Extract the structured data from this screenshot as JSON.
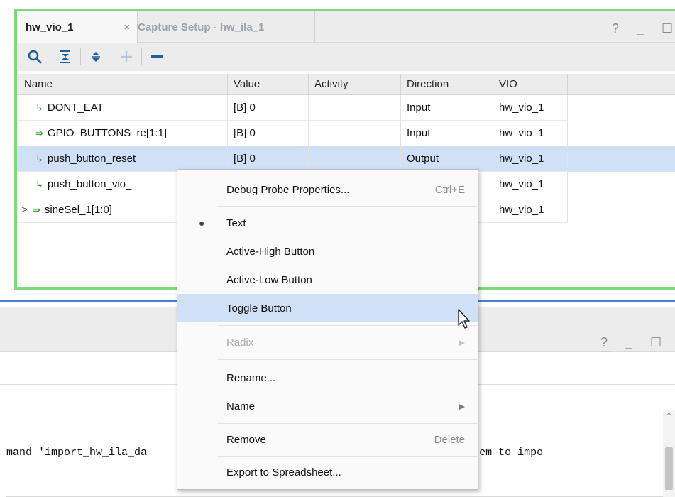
{
  "vio_panel": {
    "tabs": [
      {
        "label": "hw_vio_1",
        "close": "×"
      },
      {
        "label": "Capture Setup - hw_ila_1"
      }
    ],
    "window_controls": "? _ ☐",
    "toolbar_icons": [
      "search-icon",
      "collapse-all-icon",
      "expand-all-icon",
      "add-icon",
      "remove-icon"
    ],
    "columns": [
      "Name",
      "Value",
      "Activity",
      "Direction",
      "VIO"
    ],
    "rows": [
      {
        "expander": "",
        "name": "DONT_EAT",
        "value": "[B] 0",
        "activity": "",
        "direction": "Input",
        "vio": "hw_vio_1"
      },
      {
        "expander": "",
        "name": "GPIO_BUTTONS_re[1:1]",
        "value": "[B] 0",
        "activity": "",
        "direction": "Input",
        "vio": "hw_vio_1"
      },
      {
        "expander": "",
        "name": "push_button_reset",
        "value": "[B] 0",
        "activity": "",
        "direction": "Output",
        "vio": "hw_vio_1"
      },
      {
        "expander": "",
        "name": "push_button_vio_",
        "value": "",
        "activity": "",
        "direction": "",
        "vio": "hw_vio_1"
      },
      {
        "expander": ">",
        "name": "sineSel_1[1:0]",
        "value": "",
        "activity": "",
        "direction": "",
        "vio": "hw_vio_1"
      }
    ]
  },
  "bottom_panel": {
    "window_controls": "? _ ☐ ☐",
    "console_text": "mand 'import_hw_ila_da                                      A Data menu item to impo"
  },
  "context_menu": {
    "items": [
      {
        "label": "Debug Probe Properties...",
        "shortcut": "Ctrl+E"
      },
      {
        "label": "Text",
        "checked": "●"
      },
      {
        "label": "Active-High Button"
      },
      {
        "label": "Active-Low Button"
      },
      {
        "label": "Toggle Button"
      },
      {
        "label": "Radix",
        "arrow": "▶"
      },
      {
        "label": "Rename..."
      },
      {
        "label": "Name",
        "arrow": "▶"
      },
      {
        "label": "Remove",
        "shortcut": "Delete"
      },
      {
        "label": "Export to Spreadsheet..."
      }
    ]
  },
  "colors": {
    "panel_border": "#7fd87a",
    "selection": "#cfe0f7",
    "splitter": "#4a7fd1",
    "toolbar_icon": "#1d5fa0"
  }
}
